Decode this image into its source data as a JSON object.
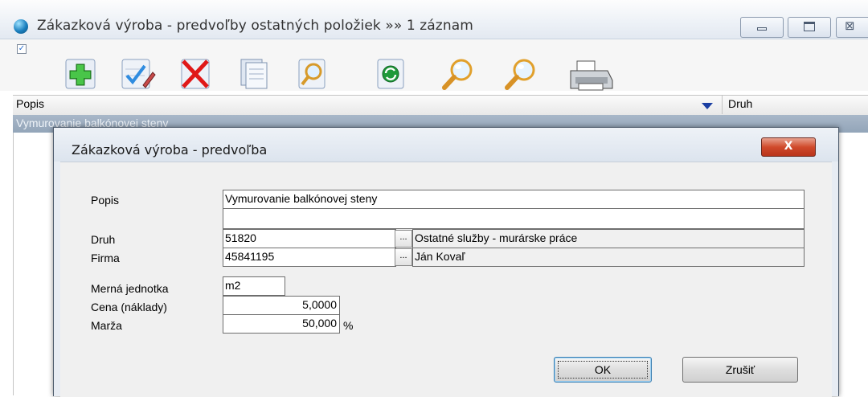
{
  "window": {
    "title": "Zákazková výroba - predvoľby ostatných položiek »» 1 záznam"
  },
  "toolbar": {
    "checkbox_checked": true,
    "buttons": [
      {
        "name": "add-icon"
      },
      {
        "name": "edit-icon"
      },
      {
        "name": "delete-icon"
      },
      {
        "name": "copy-icon"
      },
      {
        "name": "find-page-icon"
      },
      {
        "name": "refresh-icon"
      },
      {
        "name": "search-icon"
      },
      {
        "name": "search-next-icon"
      },
      {
        "name": "print-icon"
      }
    ]
  },
  "grid": {
    "columns": [
      "Popis",
      "Druh"
    ],
    "rows": [
      {
        "popis": "Vymurovanie balkónovej steny",
        "selected": true
      }
    ]
  },
  "dialog": {
    "title": "Zákazková výroba - predvoľba",
    "close_glyph": "X",
    "labels": {
      "popis": "Popis",
      "druh": "Druh",
      "firma": "Firma",
      "merna_jednotka": "Merná jednotka",
      "cena": "Cena (náklady)",
      "marza": "Marža"
    },
    "values": {
      "popis": "Vymurovanie balkónovej steny",
      "popis_line2": "",
      "druh_code": "51820",
      "druh_name": "Ostatné služby - murárske práce",
      "firma_code": "45841195",
      "firma_name": "Ján Kovaľ",
      "merna_jednotka": "m2",
      "cena": "5,0000",
      "marza": "50,000"
    },
    "marza_unit": "%",
    "ellipsis": "...",
    "ok_label": "OK",
    "cancel_label": "Zrušiť"
  },
  "colors": {
    "selected_row": "#9aabbe",
    "dialog_close": "#c9432a",
    "delete_red": "#e01818",
    "add_green": "#2fa52f"
  }
}
